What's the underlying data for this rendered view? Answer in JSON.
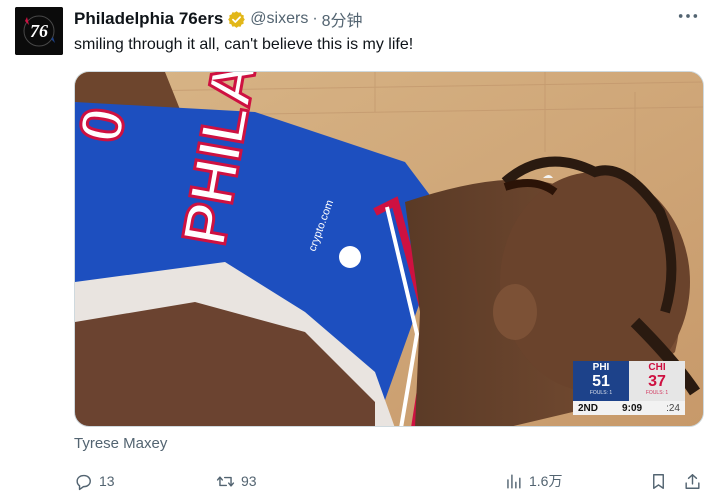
{
  "tweet": {
    "display_name": "Philadelphia 76ers",
    "verified_icon": "verified-badge-gold",
    "handle": "@sixers",
    "separator": "·",
    "time": "8分钟",
    "text": "smiling through it all, can't believe this is my life!",
    "avatar_icon": "sixers-76-logo",
    "more_icon": "more-dots-icon"
  },
  "media": {
    "description_icon": "player-photo",
    "jersey_text": "PHILA",
    "jersey_number": "0",
    "sponsor": "crypto.com"
  },
  "scoreboard": {
    "home_abbr": "PHI",
    "home_score": "51",
    "home_fouls": "FOULS: 1",
    "away_abbr": "CHI",
    "away_score": "37",
    "away_fouls": "FOULS: 1",
    "quarter": "2ND",
    "clock": "9:09",
    "shot_clock": ":24",
    "colors": {
      "home": "#1d428a",
      "away": "#ce1141"
    }
  },
  "caption": "Tyrese Maxey",
  "actions": {
    "reply_count": "13",
    "repost_count": "93",
    "views_count": "1.6万",
    "icons": [
      "reply-icon",
      "repost-icon",
      "views-icon",
      "bookmark-icon",
      "share-icon"
    ]
  },
  "colors": {
    "secondary_text": "#536471",
    "border": "#cfd9de",
    "verified_gold": "#e2b719"
  }
}
